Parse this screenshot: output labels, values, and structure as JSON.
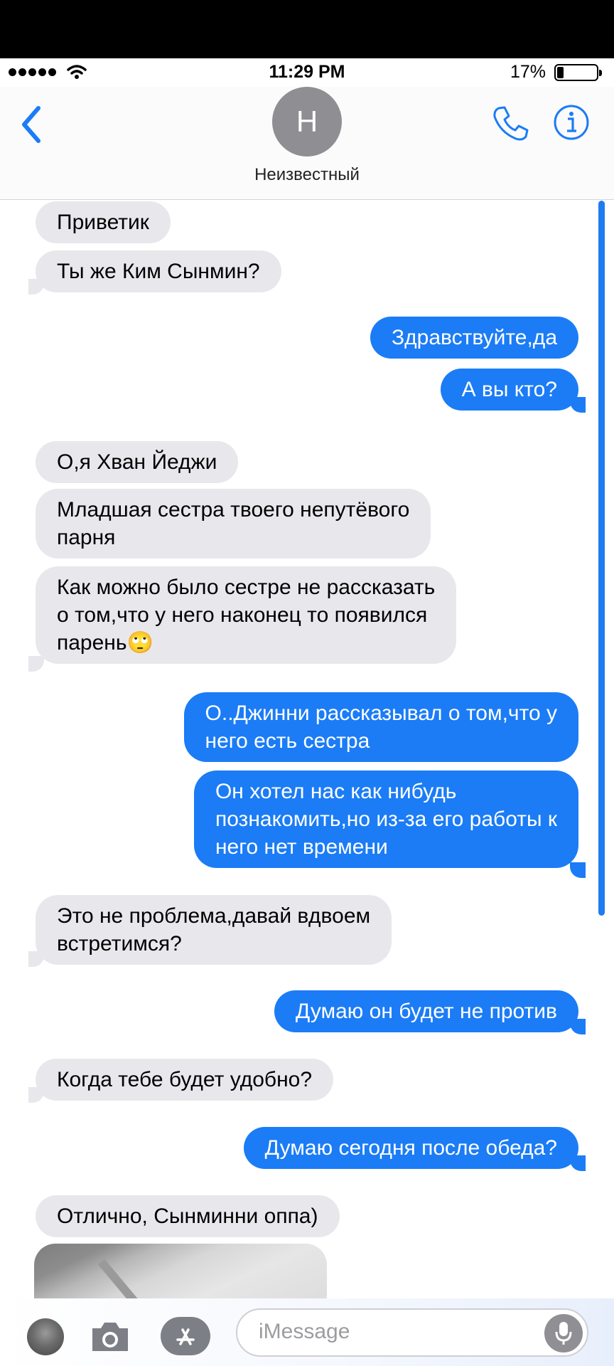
{
  "status_bar": {
    "time": "11:29 PM",
    "battery": "17%"
  },
  "contact": {
    "initial": "Н",
    "name": "Неизвестный"
  },
  "messages": [
    {
      "dir": "in",
      "text": "Приветик"
    },
    {
      "dir": "in",
      "text": "Ты же Ким Сынмин?"
    },
    {
      "dir": "out",
      "text": "Здравствуйте,да"
    },
    {
      "dir": "out",
      "text": "А вы кто?"
    },
    {
      "dir": "in",
      "text": "О,я Хван Йеджи"
    },
    {
      "dir": "in",
      "text": "Младшая сестра твоего непутёвого\nпарня"
    },
    {
      "dir": "in",
      "text": "Как можно было сестре не рассказать\nо том,что у него наконец то появился\nпарень🙄"
    },
    {
      "dir": "out",
      "text": "О..Джинни рассказывал о том,что у\nнего есть сестра"
    },
    {
      "dir": "out",
      "text": "Он хотел нас как нибудь\nпознакомить,но из-за его работы к\nнего нет времени"
    },
    {
      "dir": "in",
      "text": "Это не проблема,давай вдвоем\nвстретимся?"
    },
    {
      "dir": "out",
      "text": "Думаю он будет не против"
    },
    {
      "dir": "in",
      "text": "Когда тебе будет удобно?"
    },
    {
      "dir": "out",
      "text": "Думаю сегодня после обеда?"
    },
    {
      "dir": "in",
      "text": "Отлично, Сынминни оппа)"
    }
  ],
  "composer": {
    "placeholder": "iMessage"
  }
}
